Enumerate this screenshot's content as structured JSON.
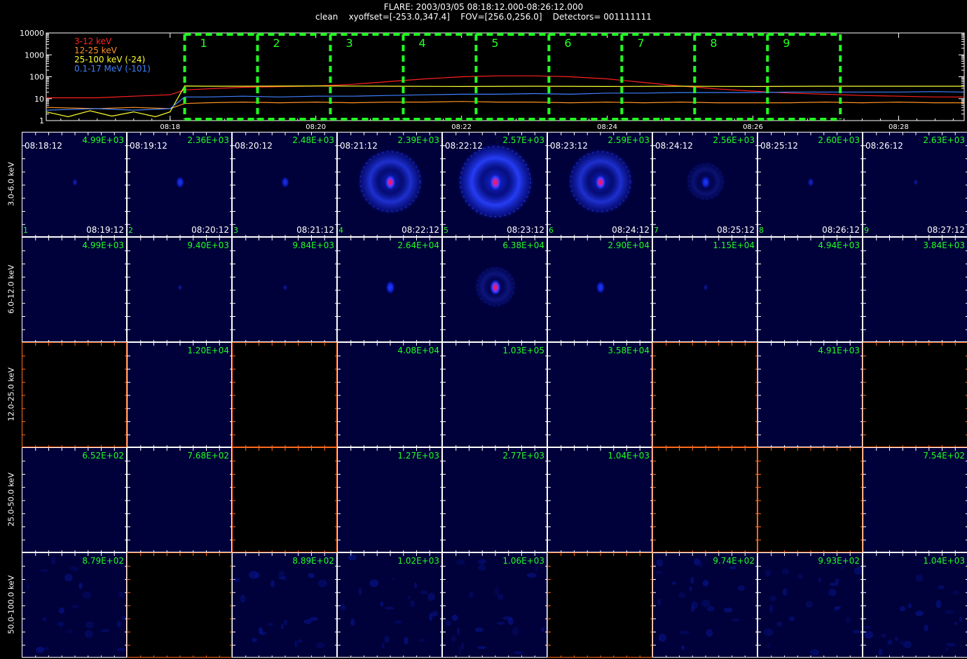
{
  "header": {
    "line1": "FLARE: 2003/03/05 08:18:12.000-08:26:12.000",
    "line2": "clean    xyoffset=[-253.0,347.4]    FOV=[256.0,256.0]    Detectors= 001111111"
  },
  "chart_data": [
    {
      "type": "line",
      "y_scale": "log",
      "ylim": [
        1,
        10000
      ],
      "y_ticks": [
        "10000",
        "1000",
        "100",
        "10",
        "1"
      ],
      "x_ticks": [
        "08:18",
        "08:20",
        "08:22",
        "08:24",
        "08:26",
        "08:28"
      ],
      "x_tick_minutes": [
        18,
        20,
        22,
        24,
        26,
        28
      ],
      "xlim_minutes": [
        16.3,
        28.9
      ],
      "legend": [
        "3-12 keV",
        "12-25 keV",
        "25-100 keV (-24)",
        "0.1-17 MeV (-101)"
      ],
      "interval_labels": [
        "1",
        "2",
        "3",
        "4",
        "5",
        "6",
        "7",
        "8",
        "9"
      ],
      "interval_start_minutes": [
        18.2,
        19.2,
        20.2,
        21.2,
        22.2,
        23.2,
        24.2,
        25.2,
        26.2,
        27.2
      ],
      "series": [
        {
          "name": "3-12 keV",
          "color": "#ff2020",
          "x": [
            16.3,
            17,
            17.5,
            18,
            18.2,
            18.5,
            19,
            19.5,
            20,
            20.5,
            21,
            21.5,
            22,
            22.5,
            23,
            23.5,
            24,
            24.5,
            25,
            25.5,
            26,
            26.5,
            27,
            27.5,
            28,
            28.5,
            28.9
          ],
          "y": [
            11,
            11,
            13,
            15,
            25,
            28,
            33,
            35,
            38,
            45,
            60,
            80,
            100,
            110,
            110,
            100,
            80,
            55,
            38,
            28,
            22,
            18,
            16,
            14,
            13,
            12,
            12
          ]
        },
        {
          "name": "12-25 keV",
          "color": "#ff9020",
          "x": [
            16.3,
            17,
            17.5,
            18,
            18.2,
            18.5,
            19,
            19.5,
            20,
            20.5,
            21,
            21.5,
            22,
            22.5,
            23,
            23.5,
            24,
            24.5,
            25,
            25.5,
            26,
            26.5,
            27,
            27.5,
            28,
            28.5,
            28.9
          ],
          "y": [
            4,
            3.5,
            4,
            3.5,
            6,
            6.5,
            7,
            6.5,
            7,
            6.5,
            7,
            7,
            7.5,
            7,
            7,
            6.5,
            7,
            6.5,
            7,
            6.5,
            6.5,
            6.5,
            7,
            6.5,
            7,
            6.5,
            6.5
          ]
        },
        {
          "name": "25-100 keV (-24)",
          "color": "#ffff30",
          "x": [
            16.3,
            16.6,
            16.9,
            17.2,
            17.5,
            17.8,
            18,
            18.2,
            18.5,
            19,
            20,
            21,
            22,
            23,
            24,
            25,
            26,
            27,
            28,
            28.9
          ],
          "y": [
            2.5,
            1.5,
            2.8,
            1.6,
            2.5,
            1.5,
            2.5,
            38,
            37,
            37,
            38,
            37,
            36,
            37,
            36,
            37,
            36,
            37,
            37,
            37
          ]
        },
        {
          "name": "0.1-17 MeV (-101)",
          "color": "#4080ff",
          "x": [
            16.3,
            17,
            17.5,
            18,
            18.2,
            18.5,
            19,
            19.5,
            20,
            20.5,
            21,
            21.5,
            22,
            22.5,
            23,
            23.5,
            24,
            24.5,
            25,
            25.5,
            26,
            26.5,
            27,
            27.5,
            28,
            28.5,
            28.9
          ],
          "y": [
            3,
            3.5,
            3,
            3.5,
            12,
            12,
            13,
            12,
            13,
            13,
            14,
            15,
            16,
            16,
            17,
            16,
            18,
            18,
            19,
            19,
            19,
            20,
            20,
            20,
            20,
            21,
            20
          ]
        }
      ]
    },
    {
      "type": "heatmap",
      "rows": [
        "3.0-6.0 keV",
        "6.0-12.0 keV",
        "12.0-25.0 keV",
        "25.0-50.0 keV",
        "50.0-100.0 keV"
      ],
      "start_times": [
        "08:18:12",
        "08:19:12",
        "08:20:12",
        "08:21:12",
        "08:22:12",
        "08:23:12",
        "08:24:12",
        "08:25:12",
        "08:26:12"
      ],
      "end_times": [
        "08:19:12",
        "08:20:12",
        "08:21:12",
        "08:22:12",
        "08:23:12",
        "08:24:12",
        "08:25:12",
        "08:26:12",
        "08:27:12"
      ],
      "max_values": [
        [
          "4.99E+03",
          "2.36E+03",
          "2.48E+03",
          "2.39E+03",
          "2.57E+03",
          "2.59E+03",
          "2.56E+03",
          "2.60E+03",
          "2.63E+03"
        ],
        [
          "4.99E+03",
          "9.40E+03",
          "9.84E+03",
          "2.64E+04",
          "6.38E+04",
          "2.90E+04",
          "1.15E+04",
          "4.94E+03",
          "3.84E+03"
        ],
        [
          "",
          "1.20E+04",
          "",
          "4.08E+04",
          "1.03E+05",
          "3.58E+04",
          "",
          "4.91E+03",
          ""
        ],
        [
          "6.52E+02",
          "7.68E+02",
          "",
          "1.27E+03",
          "2.77E+03",
          "1.04E+03",
          "",
          "",
          "7.54E+02"
        ],
        [
          "8.79E+02",
          "",
          "8.89E+02",
          "1.02E+03",
          "1.06E+03",
          "",
          "9.74E+02",
          "9.93E+02",
          "1.04E+03"
        ]
      ],
      "image_available": [
        [
          1,
          1,
          1,
          1,
          1,
          1,
          1,
          1,
          1
        ],
        [
          1,
          1,
          1,
          1,
          1,
          1,
          1,
          1,
          1
        ],
        [
          0,
          1,
          0,
          1,
          1,
          1,
          0,
          1,
          0
        ],
        [
          1,
          1,
          0,
          1,
          1,
          1,
          0,
          0,
          1
        ],
        [
          1,
          0,
          1,
          1,
          1,
          0,
          1,
          1,
          1
        ]
      ],
      "source_intensity": [
        [
          0.15,
          0.5,
          0.45,
          0.85,
          1.0,
          0.85,
          0.55,
          0.25,
          0.05
        ],
        [
          0.0,
          0.05,
          0.05,
          0.6,
          0.85,
          0.55,
          0.05,
          0.0,
          0.0
        ],
        [
          0,
          0,
          0,
          0,
          0,
          0,
          0,
          0,
          0
        ],
        [
          0,
          0,
          0,
          0,
          0,
          0,
          0,
          0,
          0
        ],
        [
          0,
          0,
          0,
          0,
          0,
          0,
          0,
          0,
          0
        ]
      ],
      "ring_intensity": [
        [
          0,
          0,
          0,
          0.8,
          1.0,
          0.8,
          0.3,
          0,
          0
        ],
        [
          0,
          0,
          0,
          0,
          0.35,
          0,
          0,
          0,
          0
        ],
        [
          0,
          0,
          0,
          0,
          0,
          0,
          0,
          0,
          0
        ],
        [
          0,
          0,
          0,
          0,
          0,
          0,
          0,
          0,
          0
        ],
        [
          0,
          0,
          0,
          0,
          0,
          0,
          0,
          0,
          0
        ]
      ],
      "noise": [
        0,
        0,
        0,
        0,
        0.6
      ],
      "colors": {
        "background": "#00003a",
        "empty": "#000000",
        "empty_axis": "#ff6a20",
        "max_label": "#22ff22",
        "source_core": "#ff2020",
        "ring": "#2030ff"
      }
    }
  ]
}
